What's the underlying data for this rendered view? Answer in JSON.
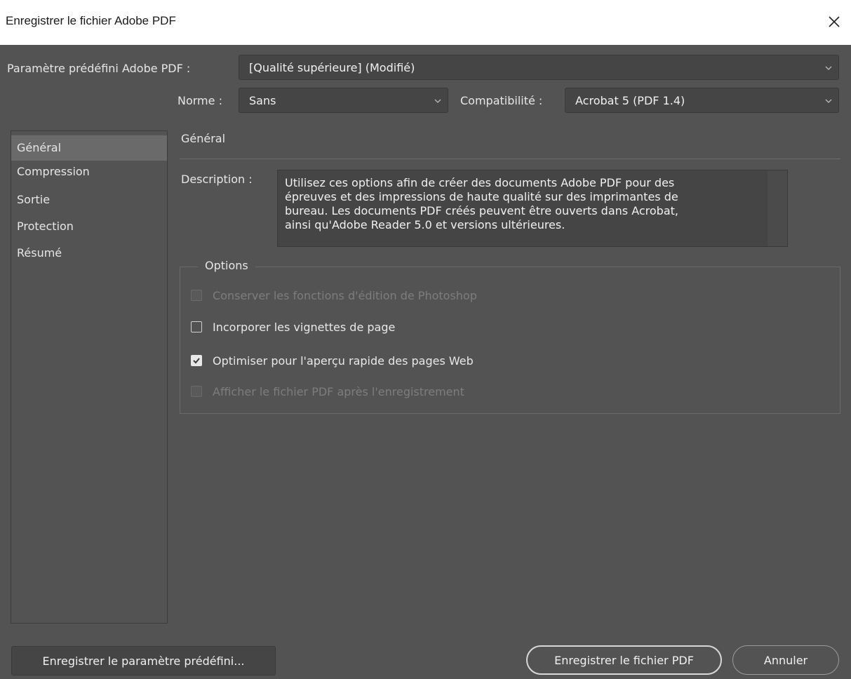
{
  "window": {
    "title": "Enregistrer le fichier Adobe PDF",
    "close_icon": "close-icon"
  },
  "preset": {
    "label": "Paramètre prédéfini Adobe PDF :",
    "value": "[Qualité supérieure] (Modifié)"
  },
  "standard": {
    "label": "Norme :",
    "value": "Sans"
  },
  "compatibility": {
    "label": "Compatibilité :",
    "value": "Acrobat 5 (PDF 1.4)"
  },
  "sidebar": {
    "items": [
      {
        "label": "Général",
        "active": true
      },
      {
        "label": "Compression",
        "active": false
      },
      {
        "label": "Sortie",
        "active": false
      },
      {
        "label": "Protection",
        "active": false
      },
      {
        "label": "Résumé",
        "active": false
      }
    ]
  },
  "panel": {
    "title": "Général",
    "description_label": "Description :",
    "description_lines": [
      "Utilisez ces options afin de créer des documents Adobe PDF pour des",
      "épreuves et des impressions de haute qualité sur des imprimantes de",
      "bureau. Les documents PDF créés peuvent être ouverts dans Acrobat,",
      "ainsi qu'Adobe Reader 5.0 et versions ultérieures."
    ]
  },
  "options": {
    "legend": "Options",
    "items": [
      {
        "label": "Conserver les fonctions d'édition de Photoshop",
        "checked": false,
        "disabled": true
      },
      {
        "label": "Incorporer les vignettes de page",
        "checked": false,
        "disabled": false
      },
      {
        "label": "Optimiser pour l'aperçu rapide des pages Web",
        "checked": true,
        "disabled": false
      },
      {
        "label": "Afficher le fichier PDF après l'enregistrement",
        "checked": false,
        "disabled": true
      }
    ]
  },
  "buttons": {
    "save_preset": "Enregistrer le paramètre prédéfini...",
    "save_pdf": "Enregistrer le fichier PDF",
    "cancel": "Annuler"
  },
  "colors": {
    "background": "#535353",
    "field": "#454545",
    "titlebar": "#ffffff"
  }
}
